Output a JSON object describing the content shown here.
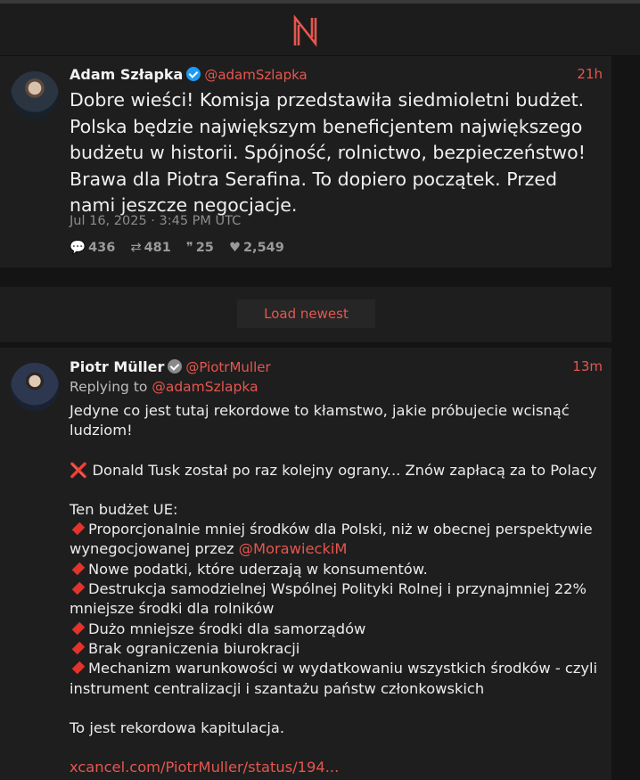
{
  "header": {
    "logo": "N"
  },
  "tweet1": {
    "author_name": "Adam Szłapka",
    "verified": "blue",
    "handle": "@adamSzlapka",
    "time": "21h",
    "text": "Dobre wieści! Komisja przedstawiła siedmioletni budżet. Polska będzie największym beneficjentem największego budżetu w historii. Spójność, rolnictwo, bezpieczeństwo! Brawa dla Piotra Serafina. To dopiero początek. Przed nami jeszcze negocjacje.",
    "date": "Jul 16, 2025 · 3:45 PM UTC",
    "stats": {
      "replies": "436",
      "retweets": "481",
      "quotes": "25",
      "likes": "2,549"
    }
  },
  "load_newest": {
    "label": "Load newest"
  },
  "tweet2": {
    "author_name": "Piotr Müller",
    "verified": "gray",
    "handle": "@PiotrMuller",
    "time": "13m",
    "replying_prefix": "Replying to",
    "replying_to": "@adamSzlapka",
    "line1": "Jedyne co jest tutaj rekordowe to kłamstwo, jakie próbujecie wcisnąć ludziom!",
    "line2_icon": "❌",
    "line2": "Donald Tusk został po raz kolejny ograny... Znów zapłacą za to Polacy",
    "line3": "Ten budżet UE:",
    "bullet1_a": "Proporcjonalnie mniej środków dla Polski, niż w obecnej perspektywie wynegocjowanej przez",
    "bullet1_mention": "@MorawieckiM",
    "bullet2": "Nowe podatki, które uderzają w konsumentów.",
    "bullet3": "Destrukcja samodzielnej Wspólnej Polityki Rolnej i przynajmniej 22% mniejsze środki dla rolników",
    "bullet4": "Dużo mniejsze środki dla samorządów",
    "bullet5": "Brak ograniczenia biurokracji",
    "bullet6": "Mechanizm warunkowości w wydatkowaniu wszystkich środków -  czyli instrument centralizacji i szantażu państw członkowskich",
    "line4": "To jest rekordowa kapitulacja.",
    "link": "xcancel.com/PiotrMuller/status/194..."
  },
  "colors": {
    "accent": "#e6564f",
    "background": "#141414",
    "card": "#1e1e1e",
    "bullet": "#e3332b"
  },
  "icons": {
    "reply": "speech-bubble-icon",
    "retweet": "retweet-icon",
    "quote": "quote-icon",
    "like": "heart-icon"
  }
}
